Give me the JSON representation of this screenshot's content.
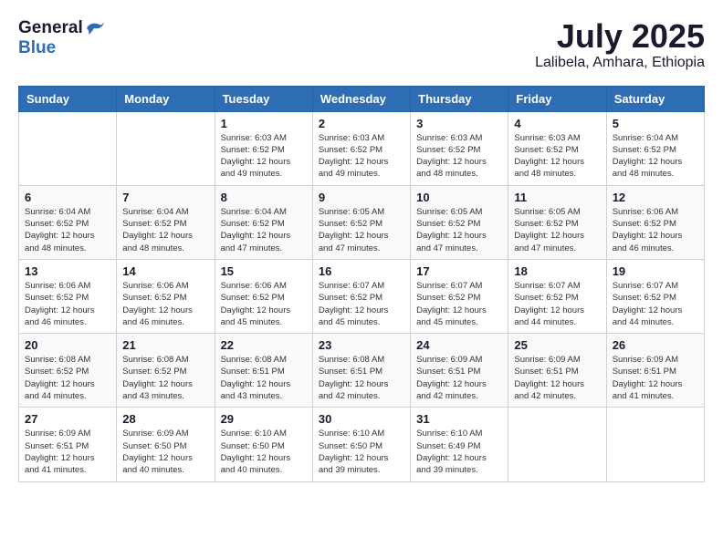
{
  "header": {
    "logo_general": "General",
    "logo_blue": "Blue",
    "month_year": "July 2025",
    "location": "Lalibela, Amhara, Ethiopia"
  },
  "days_of_week": [
    "Sunday",
    "Monday",
    "Tuesday",
    "Wednesday",
    "Thursday",
    "Friday",
    "Saturday"
  ],
  "weeks": [
    [
      {
        "day": "",
        "info": ""
      },
      {
        "day": "",
        "info": ""
      },
      {
        "day": "1",
        "info": "Sunrise: 6:03 AM\nSunset: 6:52 PM\nDaylight: 12 hours\nand 49 minutes."
      },
      {
        "day": "2",
        "info": "Sunrise: 6:03 AM\nSunset: 6:52 PM\nDaylight: 12 hours\nand 49 minutes."
      },
      {
        "day": "3",
        "info": "Sunrise: 6:03 AM\nSunset: 6:52 PM\nDaylight: 12 hours\nand 48 minutes."
      },
      {
        "day": "4",
        "info": "Sunrise: 6:03 AM\nSunset: 6:52 PM\nDaylight: 12 hours\nand 48 minutes."
      },
      {
        "day": "5",
        "info": "Sunrise: 6:04 AM\nSunset: 6:52 PM\nDaylight: 12 hours\nand 48 minutes."
      }
    ],
    [
      {
        "day": "6",
        "info": "Sunrise: 6:04 AM\nSunset: 6:52 PM\nDaylight: 12 hours\nand 48 minutes."
      },
      {
        "day": "7",
        "info": "Sunrise: 6:04 AM\nSunset: 6:52 PM\nDaylight: 12 hours\nand 48 minutes."
      },
      {
        "day": "8",
        "info": "Sunrise: 6:04 AM\nSunset: 6:52 PM\nDaylight: 12 hours\nand 47 minutes."
      },
      {
        "day": "9",
        "info": "Sunrise: 6:05 AM\nSunset: 6:52 PM\nDaylight: 12 hours\nand 47 minutes."
      },
      {
        "day": "10",
        "info": "Sunrise: 6:05 AM\nSunset: 6:52 PM\nDaylight: 12 hours\nand 47 minutes."
      },
      {
        "day": "11",
        "info": "Sunrise: 6:05 AM\nSunset: 6:52 PM\nDaylight: 12 hours\nand 47 minutes."
      },
      {
        "day": "12",
        "info": "Sunrise: 6:06 AM\nSunset: 6:52 PM\nDaylight: 12 hours\nand 46 minutes."
      }
    ],
    [
      {
        "day": "13",
        "info": "Sunrise: 6:06 AM\nSunset: 6:52 PM\nDaylight: 12 hours\nand 46 minutes."
      },
      {
        "day": "14",
        "info": "Sunrise: 6:06 AM\nSunset: 6:52 PM\nDaylight: 12 hours\nand 46 minutes."
      },
      {
        "day": "15",
        "info": "Sunrise: 6:06 AM\nSunset: 6:52 PM\nDaylight: 12 hours\nand 45 minutes."
      },
      {
        "day": "16",
        "info": "Sunrise: 6:07 AM\nSunset: 6:52 PM\nDaylight: 12 hours\nand 45 minutes."
      },
      {
        "day": "17",
        "info": "Sunrise: 6:07 AM\nSunset: 6:52 PM\nDaylight: 12 hours\nand 45 minutes."
      },
      {
        "day": "18",
        "info": "Sunrise: 6:07 AM\nSunset: 6:52 PM\nDaylight: 12 hours\nand 44 minutes."
      },
      {
        "day": "19",
        "info": "Sunrise: 6:07 AM\nSunset: 6:52 PM\nDaylight: 12 hours\nand 44 minutes."
      }
    ],
    [
      {
        "day": "20",
        "info": "Sunrise: 6:08 AM\nSunset: 6:52 PM\nDaylight: 12 hours\nand 44 minutes."
      },
      {
        "day": "21",
        "info": "Sunrise: 6:08 AM\nSunset: 6:52 PM\nDaylight: 12 hours\nand 43 minutes."
      },
      {
        "day": "22",
        "info": "Sunrise: 6:08 AM\nSunset: 6:51 PM\nDaylight: 12 hours\nand 43 minutes."
      },
      {
        "day": "23",
        "info": "Sunrise: 6:08 AM\nSunset: 6:51 PM\nDaylight: 12 hours\nand 42 minutes."
      },
      {
        "day": "24",
        "info": "Sunrise: 6:09 AM\nSunset: 6:51 PM\nDaylight: 12 hours\nand 42 minutes."
      },
      {
        "day": "25",
        "info": "Sunrise: 6:09 AM\nSunset: 6:51 PM\nDaylight: 12 hours\nand 42 minutes."
      },
      {
        "day": "26",
        "info": "Sunrise: 6:09 AM\nSunset: 6:51 PM\nDaylight: 12 hours\nand 41 minutes."
      }
    ],
    [
      {
        "day": "27",
        "info": "Sunrise: 6:09 AM\nSunset: 6:51 PM\nDaylight: 12 hours\nand 41 minutes."
      },
      {
        "day": "28",
        "info": "Sunrise: 6:09 AM\nSunset: 6:50 PM\nDaylight: 12 hours\nand 40 minutes."
      },
      {
        "day": "29",
        "info": "Sunrise: 6:10 AM\nSunset: 6:50 PM\nDaylight: 12 hours\nand 40 minutes."
      },
      {
        "day": "30",
        "info": "Sunrise: 6:10 AM\nSunset: 6:50 PM\nDaylight: 12 hours\nand 39 minutes."
      },
      {
        "day": "31",
        "info": "Sunrise: 6:10 AM\nSunset: 6:49 PM\nDaylight: 12 hours\nand 39 minutes."
      },
      {
        "day": "",
        "info": ""
      },
      {
        "day": "",
        "info": ""
      }
    ]
  ]
}
